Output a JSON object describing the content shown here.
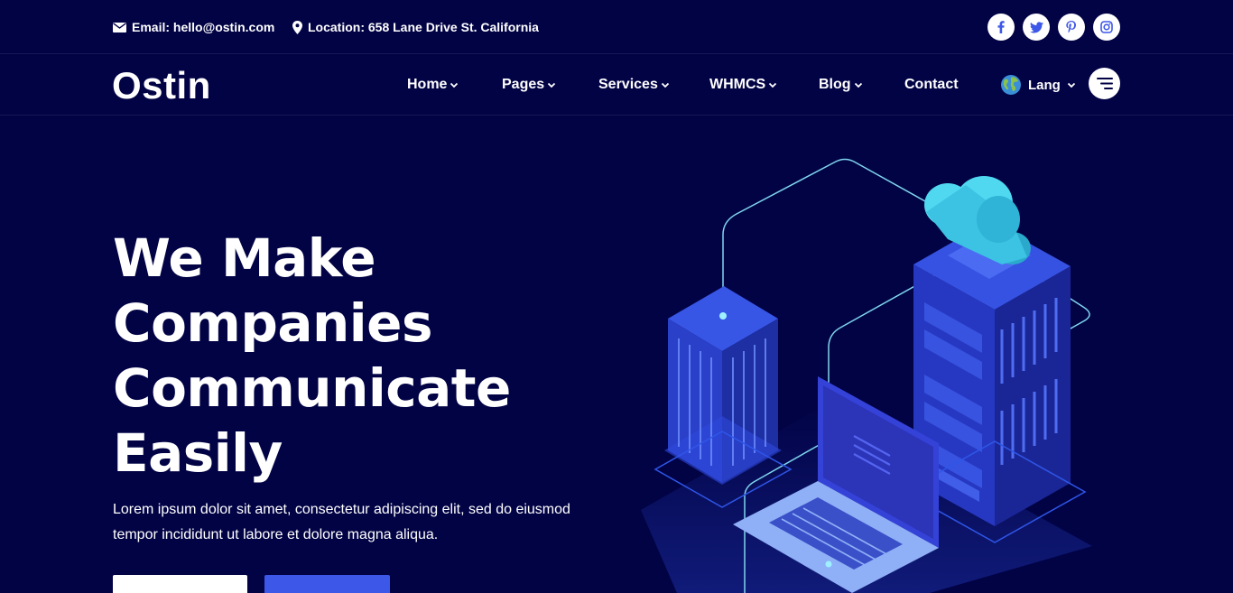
{
  "contact": {
    "email": "Email: hello@ostin.com",
    "location": "Location: 658 Lane Drive St. California"
  },
  "socials": [
    "facebook-icon",
    "twitter-icon",
    "pinterest-icon",
    "instagram-icon"
  ],
  "brand": {
    "logo": "Ostin"
  },
  "nav": {
    "home": "Home",
    "pages": "Pages",
    "services": "Services",
    "whmcs": "WHMCS",
    "blog": "Blog",
    "contact": "Contact",
    "lang": "Lang"
  },
  "hero": {
    "title_lines": [
      "We Make",
      "Companies",
      "Communicate",
      "Easily"
    ],
    "description": "Lorem ipsum dolor sit amet, consectetur adipiscing elit, sed do eiusmod tempor incididunt ut labore et dolore magna aliqua.",
    "primary_button": "",
    "secondary_button": ""
  },
  "colors": {
    "background": "#020345",
    "accent": "#3d57e8",
    "illustration_cyan": "#4fd8f0"
  }
}
